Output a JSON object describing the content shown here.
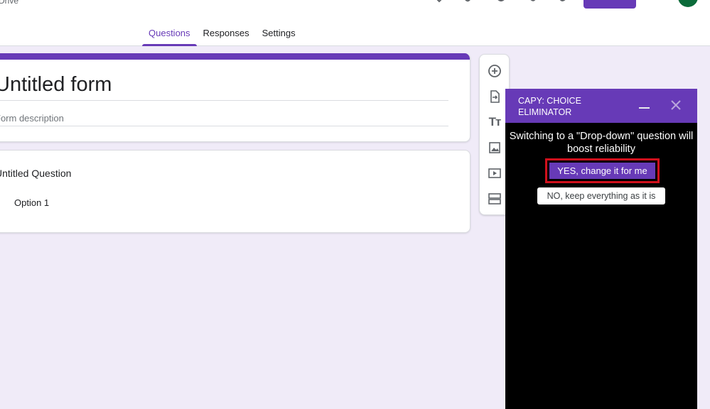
{
  "header": {
    "drive_label": "Drive",
    "tabs": [
      {
        "label": "Questions",
        "active": true
      },
      {
        "label": "Responses",
        "active": false
      },
      {
        "label": "Settings",
        "active": false
      }
    ],
    "accent_color": "#673ab7"
  },
  "form": {
    "title": "Untitled form",
    "description_placeholder": "Form description",
    "question": {
      "title": "Untitled Question",
      "options": [
        "Option 1"
      ]
    }
  },
  "toolbar": {
    "items": [
      {
        "icon": "add-question-icon"
      },
      {
        "icon": "import-questions-icon"
      },
      {
        "icon": "add-title-icon",
        "glyph": "Tт"
      },
      {
        "icon": "add-image-icon"
      },
      {
        "icon": "add-video-icon"
      },
      {
        "icon": "add-section-icon"
      }
    ]
  },
  "capy": {
    "title": "CAPY: CHOICE ELIMINATOR",
    "message": "Switching to a \"Drop-down\" question will boost reliability",
    "yes_label": "YES, change it for me",
    "no_label": "NO, keep everything as it is",
    "highlight_color": "#d0101c",
    "background_color": "#000000"
  }
}
